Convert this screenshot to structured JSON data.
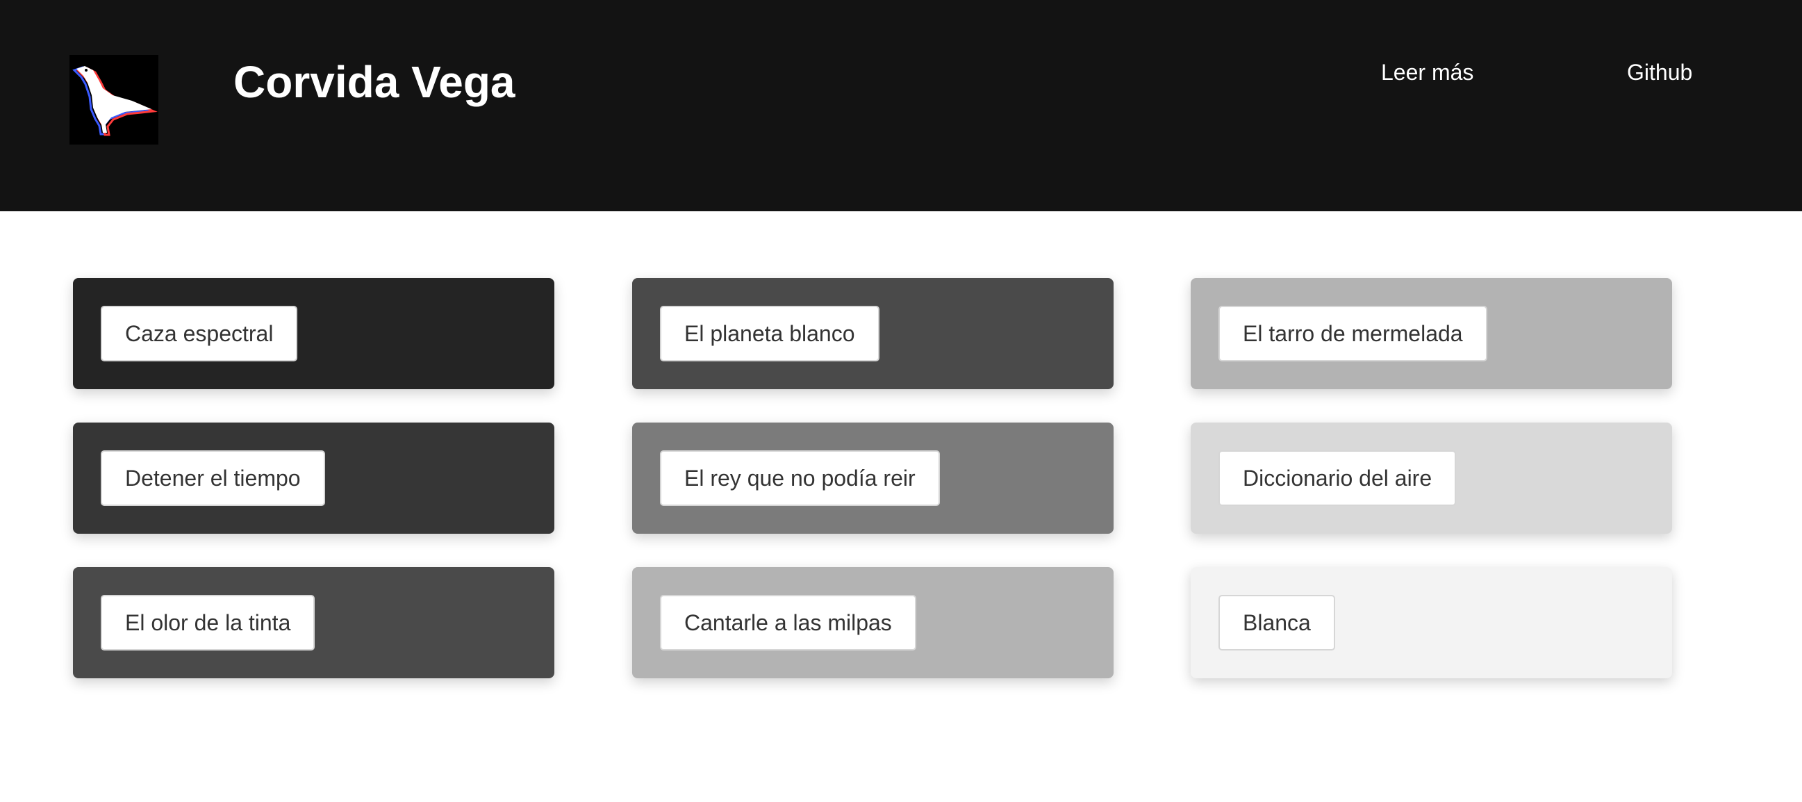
{
  "header": {
    "title": "Corvida Vega",
    "logo_icon": "crow-icon",
    "nav": [
      {
        "label": "Leer más"
      },
      {
        "label": "Github"
      }
    ]
  },
  "colors": {
    "header_bg": "#131313",
    "page_bg": "#ffffff"
  },
  "cards": [
    {
      "label": "Caza espectral",
      "color": "#242424"
    },
    {
      "label": "El planeta blanco",
      "color": "#4a4a4a"
    },
    {
      "label": "El tarro de mermelada",
      "color": "#b3b3b3"
    },
    {
      "label": "Detener el tiempo",
      "color": "#363636"
    },
    {
      "label": "El rey que no podía reir",
      "color": "#7b7b7b"
    },
    {
      "label": "Diccionario del aire",
      "color": "#d9d9d9"
    },
    {
      "label": "El olor de la tinta",
      "color": "#4a4a4a"
    },
    {
      "label": "Cantarle a las milpas",
      "color": "#b3b3b3"
    },
    {
      "label": "Blanca",
      "color": "#f3f3f3"
    }
  ]
}
